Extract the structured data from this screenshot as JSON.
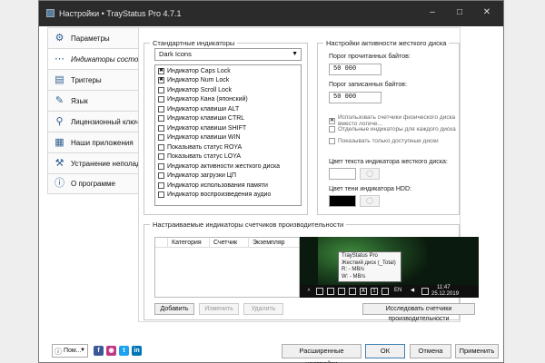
{
  "window": {
    "title": "Настройки • TrayStatus Pro 4.7.1"
  },
  "sidebar": {
    "items": [
      {
        "label": "Параметры",
        "icon": "gear-icon"
      },
      {
        "label": "Индикаторы состояния",
        "icon": "indicators-icon"
      },
      {
        "label": "Триггеры",
        "icon": "triggers-icon"
      },
      {
        "label": "Язык",
        "icon": "language-icon"
      },
      {
        "label": "Лицензионный ключ",
        "icon": "key-icon"
      },
      {
        "label": "Наши приложения",
        "icon": "apps-icon"
      },
      {
        "label": "Устранение неполадок",
        "icon": "wrench-icon"
      },
      {
        "label": "О программе",
        "icon": "info-icon"
      }
    ]
  },
  "standard": {
    "title": "Стандартные индикаторы",
    "theme_select": "Dark Icons",
    "items": [
      {
        "label": "Индикатор Caps Lock",
        "checked": true
      },
      {
        "label": "Индикатор Num Lock",
        "checked": true
      },
      {
        "label": "Индикатор Scroll Lock",
        "checked": false
      },
      {
        "label": "Индикатор Кана (японский)",
        "checked": false
      },
      {
        "label": "Индикатор клавиши ALT",
        "checked": false
      },
      {
        "label": "Индикатор клавиши CTRL",
        "checked": false
      },
      {
        "label": "Индикатор клавиши SHIFT",
        "checked": false
      },
      {
        "label": "Индикатор клавиши WIN",
        "checked": false
      },
      {
        "label": "Показывать статус ROYA",
        "checked": false
      },
      {
        "label": "Показывать статус LOYA",
        "checked": false
      },
      {
        "label": "Индикатор активности жесткого диска",
        "checked": false
      },
      {
        "label": "Индикатор загрузки ЦП",
        "checked": false
      },
      {
        "label": "Индикатор использования памяти",
        "checked": false
      },
      {
        "label": "Индикатор воспроизведения аудио",
        "checked": false
      }
    ]
  },
  "disk": {
    "title": "Настройки активности жесткого диска",
    "read_label": "Порог прочитанных байтов:",
    "read_value": "50 000",
    "write_label": "Порог записанных байтов:",
    "write_value": "50 000",
    "check_physical": "Использовать счетчики физического диска вместо логиче...",
    "check_each": "Отдельные индикаторы для каждого диска",
    "check_available": "Показывать только доступные диски",
    "text_color_label": "Цвет текста индикатора жесткого диска:",
    "shadow_color_label": "Цвет тени индикатора HDD:",
    "text_color": "#ffffff",
    "shadow_color": "#000000"
  },
  "custom": {
    "title": "Настраиваемые индикаторы счетчиков производительности",
    "col_category": "Категория",
    "col_counter": "Счетчик",
    "col_instance": "Экземпляр",
    "add": "Добавить",
    "edit": "Изменить",
    "delete": "Удалить",
    "explore": "Исследовать счетчики производительности",
    "tooltip_line1": "TrayStatus Pro",
    "tooltip_line2": "Жесткий диск (_Total)",
    "tooltip_line3": "R: - MB/s",
    "tooltip_line4": "W: - MB/s",
    "tb_lang": "EN",
    "tb_time": "11:47",
    "tb_date": "25.12.2019"
  },
  "footer": {
    "lang": "Пом...",
    "advanced": "Расширенные настройки",
    "ok": "ОК",
    "cancel": "Отмена",
    "apply": "Применить"
  }
}
